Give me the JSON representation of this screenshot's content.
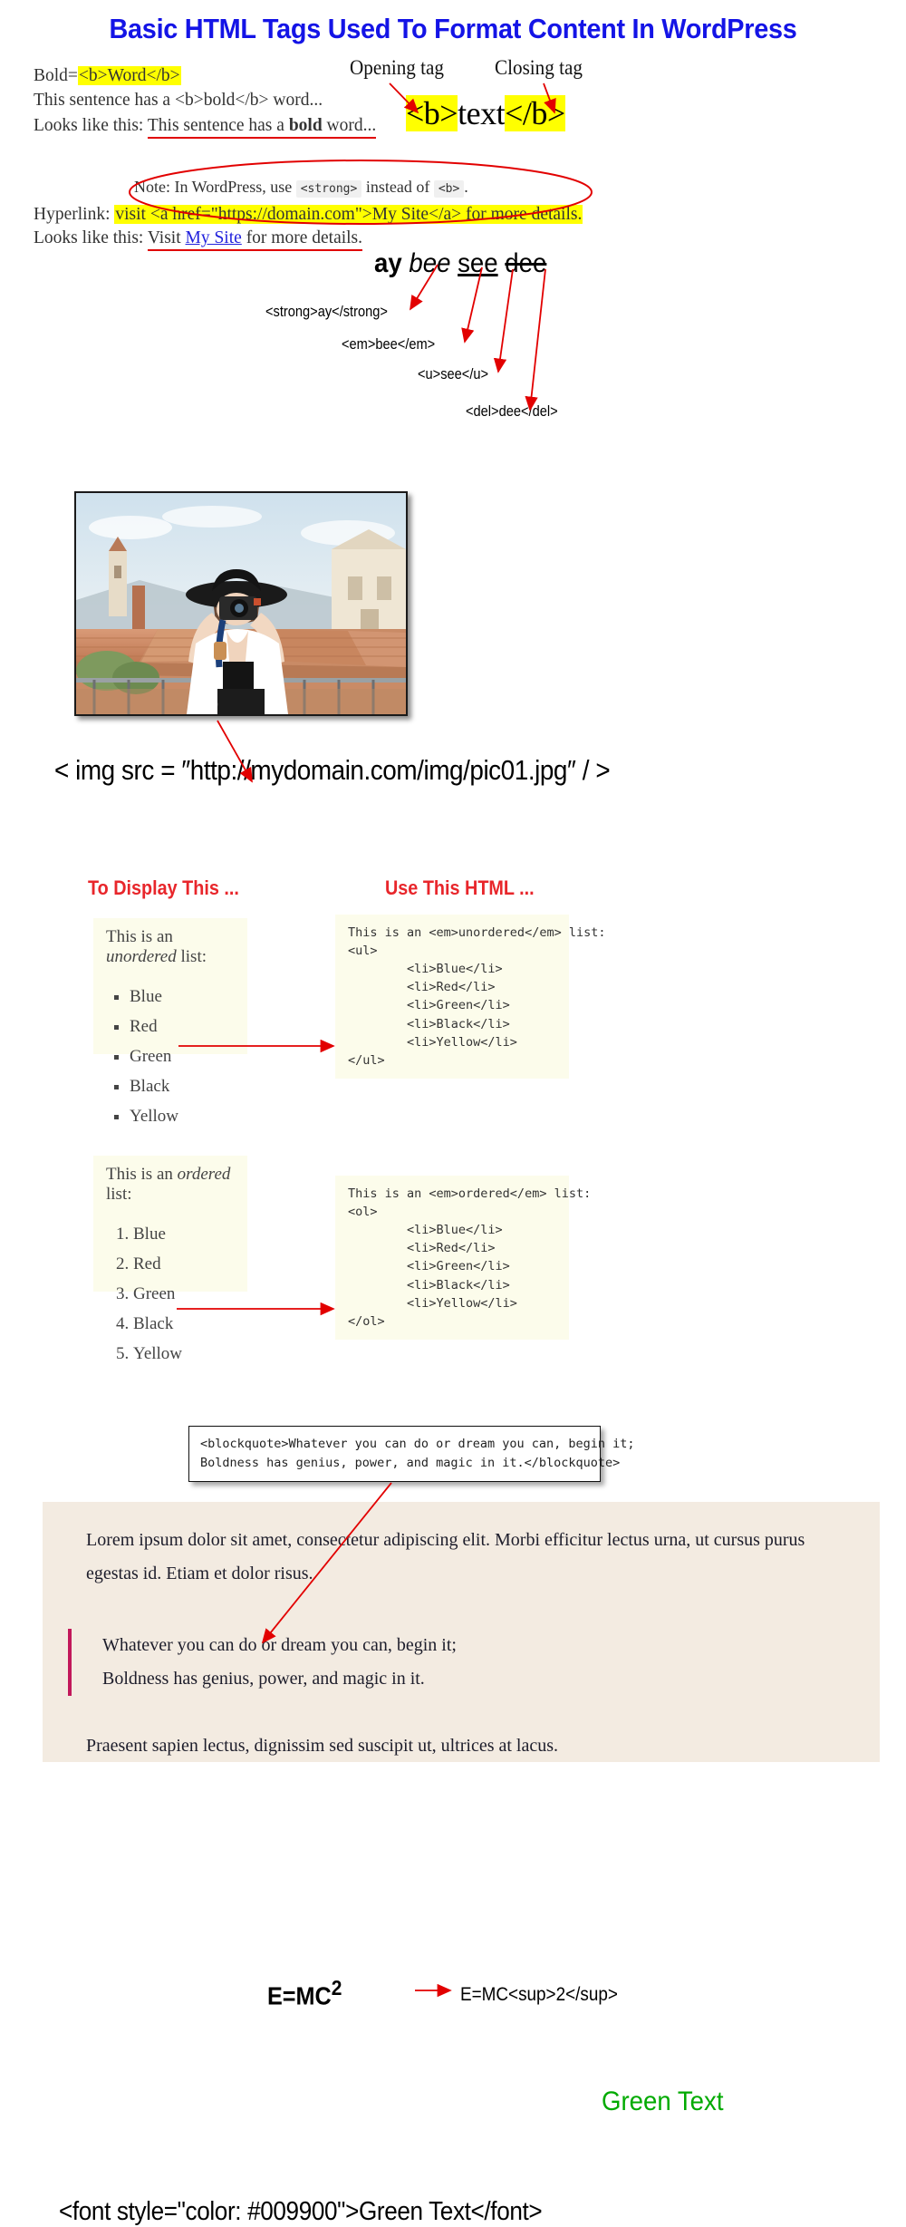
{
  "title": "Basic HTML Tags Used To Format Content In WordPress",
  "colors": {
    "title": "#1414E6",
    "highlight": "#FFFF00",
    "arrow_red": "#E20000",
    "section_header_red": "#E8262B",
    "link_blue": "#2222DD",
    "green_text": "#00AA00",
    "card_bg": "#FCFCEB",
    "lorem_bg": "#F3EBE1",
    "quote_bar": "#C2185B"
  },
  "bold_section": {
    "line1_prefix": "Bold=",
    "line1_code": "<b>Word</b>",
    "line2": "This sentence has a <b>bold</b> word...",
    "line3_prefix": "Looks like this: ",
    "line3_a": "This sentence has a ",
    "line3_bold": "bold",
    "line3_b": " word..."
  },
  "tag_anatomy": {
    "opening_label": "Opening tag",
    "closing_label": "Closing tag",
    "open_tag": "<b>",
    "middle": "text",
    "close_tag": "</b>"
  },
  "note": {
    "prefix": "Note: In WordPress, use ",
    "code_strong": "<strong>",
    "middle": " instead of ",
    "code_b": "<b>",
    "suffix": "."
  },
  "hyperlink_section": {
    "label": "Hyperlink: ",
    "code": "visit <a href=\"https://domain.com\">My Site</a> for more details.",
    "result_prefix": "Looks like this: ",
    "result_a": "Visit ",
    "result_link": "My Site",
    "result_b": " for more details."
  },
  "inline_tags": {
    "words": {
      "strong": "ay",
      "em": "bee",
      "u": "see",
      "del": "dee"
    },
    "codes": [
      "<strong>ay</strong>",
      "<em>bee</em>",
      "<u>see</u>",
      "<del>dee</del>"
    ]
  },
  "image_section": {
    "code": "< img src = ″http://mydomain.com/img/pic01.jpg″ / >"
  },
  "lists": {
    "header_left": "To Display This ...",
    "header_right": "Use This HTML ...",
    "unordered": {
      "intro_a": "This is an ",
      "intro_em": "unordered",
      "intro_b": " list:",
      "items": [
        "Blue",
        "Red",
        "Green",
        "Black",
        "Yellow"
      ],
      "code": "This is an <em>unordered</em> list:\n<ul>\n        <li>Blue</li>\n        <li>Red</li>\n        <li>Green</li>\n        <li>Black</li>\n        <li>Yellow</li>\n</ul>"
    },
    "ordered": {
      "intro_a": "This is an ",
      "intro_em": "ordered",
      "intro_b": " list:",
      "items": [
        "Blue",
        "Red",
        "Green",
        "Black",
        "Yellow"
      ],
      "code": "This is an <em>ordered</em> list:\n<ol>\n        <li>Blue</li>\n        <li>Red</li>\n        <li>Green</li>\n        <li>Black</li>\n        <li>Yellow</li>\n</ol>"
    }
  },
  "blockquote": {
    "code": "<blockquote>Whatever you can do or dream you can, begin it;\nBoldness has genius, power, and magic in it.</blockquote>",
    "paragraph1": "Lorem ipsum dolor sit amet, consectetur adipiscing elit. Morbi efficitur lectus urna, ut cursus purus egestas id. Etiam et dolor risus.",
    "quote_line1": "Whatever you can do or dream you can, begin it;",
    "quote_line2": "Boldness has genius, power, and magic in it.",
    "paragraph2": "Praesent sapien lectus, dignissim sed suscipit ut, ultrices at lacus."
  },
  "superscript_section": {
    "rendered": "E=MC",
    "rendered_sup": "2",
    "code": "E=MC<sup>2</sup>"
  },
  "font_color_section": {
    "rendered": "Green Text",
    "code": "<font style=\"color: #009900\">Green Text</font>"
  }
}
